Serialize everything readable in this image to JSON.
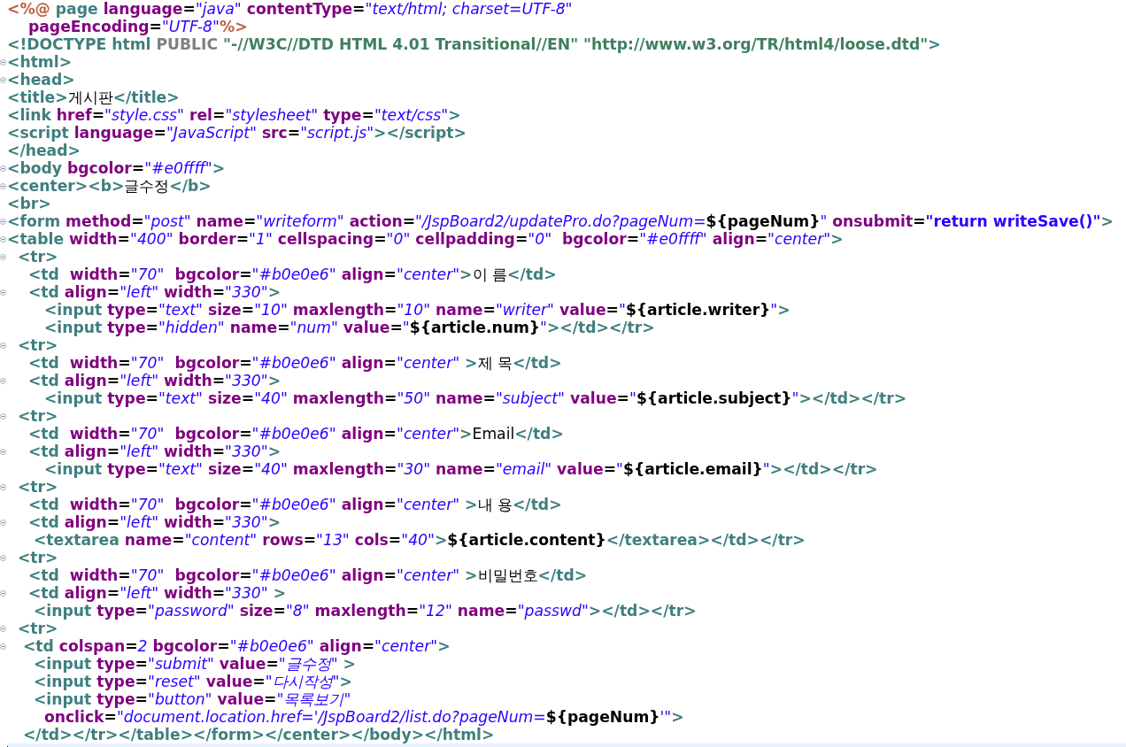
{
  "editor": {
    "lines": [
      {
        "fold": false,
        "current": false,
        "tokens": [
          {
            "kind": "directive",
            "text": "<%@"
          },
          {
            "kind": "dirname",
            "text": " page"
          },
          {
            "kind": "attr",
            "text": " language"
          },
          {
            "kind": "eq",
            "text": "="
          },
          {
            "kind": "value",
            "text": "\"java\""
          },
          {
            "kind": "attr",
            "text": " contentType"
          },
          {
            "kind": "eq",
            "text": "="
          },
          {
            "kind": "value",
            "text": "\"text/html; charset=UTF-8\""
          }
        ]
      },
      {
        "fold": false,
        "current": false,
        "tokens": [
          {
            "kind": "attr",
            "text": "    pageEncoding"
          },
          {
            "kind": "eq",
            "text": "="
          },
          {
            "kind": "value",
            "text": "\"UTF-8\""
          },
          {
            "kind": "directive",
            "text": "%>"
          }
        ]
      },
      {
        "fold": false,
        "current": false,
        "tokens": [
          {
            "kind": "tag",
            "text": "<!DOCTYPE html"
          },
          {
            "kind": "doctype",
            "text": " PUBLIC"
          },
          {
            "kind": "dtdstring",
            "text": " \"-//W3C//DTD HTML 4.01 Transitional//EN\" \"http://www.w3.org/TR/html4/loose.dtd\""
          },
          {
            "kind": "tag",
            "text": ">"
          }
        ]
      },
      {
        "fold": true,
        "current": false,
        "tokens": [
          {
            "kind": "tag",
            "text": "<html>"
          }
        ]
      },
      {
        "fold": true,
        "current": false,
        "tokens": [
          {
            "kind": "tag",
            "text": "<head>"
          }
        ]
      },
      {
        "fold": false,
        "current": false,
        "tokens": [
          {
            "kind": "tag",
            "text": "<title>"
          },
          {
            "kind": "text",
            "text": "게시판"
          },
          {
            "kind": "tag",
            "text": "</title>"
          }
        ]
      },
      {
        "fold": false,
        "current": false,
        "tokens": [
          {
            "kind": "tag",
            "text": "<link"
          },
          {
            "kind": "attr",
            "text": " href"
          },
          {
            "kind": "eq",
            "text": "="
          },
          {
            "kind": "value",
            "text": "\"style.css\""
          },
          {
            "kind": "attr",
            "text": " rel"
          },
          {
            "kind": "eq",
            "text": "="
          },
          {
            "kind": "value",
            "text": "\"stylesheet\""
          },
          {
            "kind": "attr",
            "text": " type"
          },
          {
            "kind": "eq",
            "text": "="
          },
          {
            "kind": "value",
            "text": "\"text/css\""
          },
          {
            "kind": "tag",
            "text": ">"
          }
        ]
      },
      {
        "fold": false,
        "current": false,
        "tokens": [
          {
            "kind": "tag",
            "text": "<script"
          },
          {
            "kind": "attr",
            "text": " language"
          },
          {
            "kind": "eq",
            "text": "="
          },
          {
            "kind": "value",
            "text": "\"JavaScript\""
          },
          {
            "kind": "attr",
            "text": " src"
          },
          {
            "kind": "eq",
            "text": "="
          },
          {
            "kind": "value",
            "text": "\"script.js\""
          },
          {
            "kind": "tag",
            "text": "></script>"
          }
        ]
      },
      {
        "fold": false,
        "current": false,
        "tokens": [
          {
            "kind": "tag",
            "text": "</head>"
          }
        ]
      },
      {
        "fold": true,
        "current": false,
        "tokens": [
          {
            "kind": "tag",
            "text": "<body"
          },
          {
            "kind": "attr",
            "text": " bgcolor"
          },
          {
            "kind": "eq",
            "text": "="
          },
          {
            "kind": "value",
            "text": "\"#e0ffff\""
          },
          {
            "kind": "tag",
            "text": ">"
          }
        ]
      },
      {
        "fold": true,
        "current": false,
        "tokens": [
          {
            "kind": "tag",
            "text": "<center><b>"
          },
          {
            "kind": "text",
            "text": "글수정"
          },
          {
            "kind": "tag",
            "text": "</b>"
          }
        ]
      },
      {
        "fold": false,
        "current": false,
        "tokens": [
          {
            "kind": "tag",
            "text": "<br>"
          }
        ]
      },
      {
        "fold": true,
        "current": false,
        "tokens": [
          {
            "kind": "tag",
            "text": "<form"
          },
          {
            "kind": "attr",
            "text": " method"
          },
          {
            "kind": "eq",
            "text": "="
          },
          {
            "kind": "value",
            "text": "\"post\""
          },
          {
            "kind": "attr",
            "text": " name"
          },
          {
            "kind": "eq",
            "text": "="
          },
          {
            "kind": "value",
            "text": "\"writeform\""
          },
          {
            "kind": "attr",
            "text": " action"
          },
          {
            "kind": "eq",
            "text": "="
          },
          {
            "kind": "value",
            "text": "\"/JspBoard2/updatePro.do?pageNum="
          },
          {
            "kind": "el",
            "text": "${pageNum}"
          },
          {
            "kind": "value",
            "text": "\""
          },
          {
            "kind": "attr",
            "text": " onsubmit"
          },
          {
            "kind": "eq",
            "text": "="
          },
          {
            "kind": "script",
            "text": "\"return writeSave()\""
          },
          {
            "kind": "tag",
            "text": ">"
          }
        ]
      },
      {
        "fold": true,
        "current": false,
        "tokens": [
          {
            "kind": "tag",
            "text": "<table"
          },
          {
            "kind": "attr",
            "text": " width"
          },
          {
            "kind": "eq",
            "text": "="
          },
          {
            "kind": "value",
            "text": "\"400\""
          },
          {
            "kind": "attr",
            "text": " border"
          },
          {
            "kind": "eq",
            "text": "="
          },
          {
            "kind": "value",
            "text": "\"1\""
          },
          {
            "kind": "attr",
            "text": " cellspacing"
          },
          {
            "kind": "eq",
            "text": "="
          },
          {
            "kind": "value",
            "text": "\"0\""
          },
          {
            "kind": "attr",
            "text": " cellpadding"
          },
          {
            "kind": "eq",
            "text": "="
          },
          {
            "kind": "value",
            "text": "\"0\""
          },
          {
            "kind": "attr",
            "text": "  bgcolor"
          },
          {
            "kind": "eq",
            "text": "="
          },
          {
            "kind": "value",
            "text": "\"#e0ffff\""
          },
          {
            "kind": "attr",
            "text": " align"
          },
          {
            "kind": "eq",
            "text": "="
          },
          {
            "kind": "value",
            "text": "\"center\""
          },
          {
            "kind": "tag",
            "text": ">"
          }
        ]
      },
      {
        "fold": true,
        "current": false,
        "tokens": [
          {
            "kind": "tag",
            "text": "  <tr>"
          }
        ]
      },
      {
        "fold": false,
        "current": false,
        "tokens": [
          {
            "kind": "tag",
            "text": "    <td"
          },
          {
            "kind": "attr",
            "text": "  width"
          },
          {
            "kind": "eq",
            "text": "="
          },
          {
            "kind": "value",
            "text": "\"70\""
          },
          {
            "kind": "attr",
            "text": "  bgcolor"
          },
          {
            "kind": "eq",
            "text": "="
          },
          {
            "kind": "value",
            "text": "\"#b0e0e6\""
          },
          {
            "kind": "attr",
            "text": " align"
          },
          {
            "kind": "eq",
            "text": "="
          },
          {
            "kind": "value",
            "text": "\"center\""
          },
          {
            "kind": "tag",
            "text": ">"
          },
          {
            "kind": "text",
            "text": "이 름"
          },
          {
            "kind": "tag",
            "text": "</td>"
          }
        ]
      },
      {
        "fold": true,
        "current": false,
        "tokens": [
          {
            "kind": "tag",
            "text": "    <td"
          },
          {
            "kind": "attr",
            "text": " align"
          },
          {
            "kind": "eq",
            "text": "="
          },
          {
            "kind": "value",
            "text": "\"left\""
          },
          {
            "kind": "attr",
            "text": " width"
          },
          {
            "kind": "eq",
            "text": "="
          },
          {
            "kind": "value",
            "text": "\"330\""
          },
          {
            "kind": "tag",
            "text": ">"
          }
        ]
      },
      {
        "fold": false,
        "current": false,
        "tokens": [
          {
            "kind": "tag",
            "text": "       <input"
          },
          {
            "kind": "attr",
            "text": " type"
          },
          {
            "kind": "eq",
            "text": "="
          },
          {
            "kind": "value",
            "text": "\"text\""
          },
          {
            "kind": "attr",
            "text": " size"
          },
          {
            "kind": "eq",
            "text": "="
          },
          {
            "kind": "value",
            "text": "\"10\""
          },
          {
            "kind": "attr",
            "text": " maxlength"
          },
          {
            "kind": "eq",
            "text": "="
          },
          {
            "kind": "value",
            "text": "\"10\""
          },
          {
            "kind": "attr",
            "text": " name"
          },
          {
            "kind": "eq",
            "text": "="
          },
          {
            "kind": "value",
            "text": "\"writer\""
          },
          {
            "kind": "attr",
            "text": " value"
          },
          {
            "kind": "eq",
            "text": "="
          },
          {
            "kind": "value",
            "text": "\""
          },
          {
            "kind": "el",
            "text": "${article.writer}"
          },
          {
            "kind": "value",
            "text": "\""
          },
          {
            "kind": "tag",
            "text": ">"
          }
        ]
      },
      {
        "fold": false,
        "current": false,
        "tokens": [
          {
            "kind": "tag",
            "text": "       <input"
          },
          {
            "kind": "attr",
            "text": " type"
          },
          {
            "kind": "eq",
            "text": "="
          },
          {
            "kind": "value",
            "text": "\"hidden\""
          },
          {
            "kind": "attr",
            "text": " name"
          },
          {
            "kind": "eq",
            "text": "="
          },
          {
            "kind": "value",
            "text": "\"num\""
          },
          {
            "kind": "attr",
            "text": " value"
          },
          {
            "kind": "eq",
            "text": "="
          },
          {
            "kind": "value",
            "text": "\""
          },
          {
            "kind": "el",
            "text": "${article.num}"
          },
          {
            "kind": "value",
            "text": "\""
          },
          {
            "kind": "tag",
            "text": "></td></tr>"
          }
        ]
      },
      {
        "fold": true,
        "current": false,
        "tokens": [
          {
            "kind": "tag",
            "text": "  <tr>"
          }
        ]
      },
      {
        "fold": false,
        "current": false,
        "tokens": [
          {
            "kind": "tag",
            "text": "    <td"
          },
          {
            "kind": "attr",
            "text": "  width"
          },
          {
            "kind": "eq",
            "text": "="
          },
          {
            "kind": "value",
            "text": "\"70\""
          },
          {
            "kind": "attr",
            "text": "  bgcolor"
          },
          {
            "kind": "eq",
            "text": "="
          },
          {
            "kind": "value",
            "text": "\"#b0e0e6\""
          },
          {
            "kind": "attr",
            "text": " align"
          },
          {
            "kind": "eq",
            "text": "="
          },
          {
            "kind": "value",
            "text": "\"center\""
          },
          {
            "kind": "tag",
            "text": " >"
          },
          {
            "kind": "text",
            "text": "제 목"
          },
          {
            "kind": "tag",
            "text": "</td>"
          }
        ]
      },
      {
        "fold": true,
        "current": false,
        "tokens": [
          {
            "kind": "tag",
            "text": "    <td"
          },
          {
            "kind": "attr",
            "text": " align"
          },
          {
            "kind": "eq",
            "text": "="
          },
          {
            "kind": "value",
            "text": "\"left\""
          },
          {
            "kind": "attr",
            "text": " width"
          },
          {
            "kind": "eq",
            "text": "="
          },
          {
            "kind": "value",
            "text": "\"330\""
          },
          {
            "kind": "tag",
            "text": ">"
          }
        ]
      },
      {
        "fold": false,
        "current": false,
        "tokens": [
          {
            "kind": "tag",
            "text": "       <input"
          },
          {
            "kind": "attr",
            "text": " type"
          },
          {
            "kind": "eq",
            "text": "="
          },
          {
            "kind": "value",
            "text": "\"text\""
          },
          {
            "kind": "attr",
            "text": " size"
          },
          {
            "kind": "eq",
            "text": "="
          },
          {
            "kind": "value",
            "text": "\"40\""
          },
          {
            "kind": "attr",
            "text": " maxlength"
          },
          {
            "kind": "eq",
            "text": "="
          },
          {
            "kind": "value",
            "text": "\"50\""
          },
          {
            "kind": "attr",
            "text": " name"
          },
          {
            "kind": "eq",
            "text": "="
          },
          {
            "kind": "value",
            "text": "\"subject\""
          },
          {
            "kind": "attr",
            "text": " value"
          },
          {
            "kind": "eq",
            "text": "="
          },
          {
            "kind": "value",
            "text": "\""
          },
          {
            "kind": "el",
            "text": "${article.subject}"
          },
          {
            "kind": "value",
            "text": "\""
          },
          {
            "kind": "tag",
            "text": "></td></tr>"
          }
        ]
      },
      {
        "fold": true,
        "current": false,
        "tokens": [
          {
            "kind": "tag",
            "text": "  <tr>"
          }
        ]
      },
      {
        "fold": false,
        "current": false,
        "tokens": [
          {
            "kind": "tag",
            "text": "    <td"
          },
          {
            "kind": "attr",
            "text": "  width"
          },
          {
            "kind": "eq",
            "text": "="
          },
          {
            "kind": "value",
            "text": "\"70\""
          },
          {
            "kind": "attr",
            "text": "  bgcolor"
          },
          {
            "kind": "eq",
            "text": "="
          },
          {
            "kind": "value",
            "text": "\"#b0e0e6\""
          },
          {
            "kind": "attr",
            "text": " align"
          },
          {
            "kind": "eq",
            "text": "="
          },
          {
            "kind": "value",
            "text": "\"center\""
          },
          {
            "kind": "tag",
            "text": ">"
          },
          {
            "kind": "text",
            "text": "Email"
          },
          {
            "kind": "tag",
            "text": "</td>"
          }
        ]
      },
      {
        "fold": true,
        "current": false,
        "tokens": [
          {
            "kind": "tag",
            "text": "    <td"
          },
          {
            "kind": "attr",
            "text": " align"
          },
          {
            "kind": "eq",
            "text": "="
          },
          {
            "kind": "value",
            "text": "\"left\""
          },
          {
            "kind": "attr",
            "text": " width"
          },
          {
            "kind": "eq",
            "text": "="
          },
          {
            "kind": "value",
            "text": "\"330\""
          },
          {
            "kind": "tag",
            "text": ">"
          }
        ]
      },
      {
        "fold": false,
        "current": false,
        "tokens": [
          {
            "kind": "tag",
            "text": "       <input"
          },
          {
            "kind": "attr",
            "text": " type"
          },
          {
            "kind": "eq",
            "text": "="
          },
          {
            "kind": "value",
            "text": "\"text\""
          },
          {
            "kind": "attr",
            "text": " size"
          },
          {
            "kind": "eq",
            "text": "="
          },
          {
            "kind": "value",
            "text": "\"40\""
          },
          {
            "kind": "attr",
            "text": " maxlength"
          },
          {
            "kind": "eq",
            "text": "="
          },
          {
            "kind": "value",
            "text": "\"30\""
          },
          {
            "kind": "attr",
            "text": " name"
          },
          {
            "kind": "eq",
            "text": "="
          },
          {
            "kind": "value",
            "text": "\"email\""
          },
          {
            "kind": "attr",
            "text": " value"
          },
          {
            "kind": "eq",
            "text": "="
          },
          {
            "kind": "value",
            "text": "\""
          },
          {
            "kind": "el",
            "text": "${article.email}"
          },
          {
            "kind": "value",
            "text": "\""
          },
          {
            "kind": "tag",
            "text": "></td></tr>"
          }
        ]
      },
      {
        "fold": true,
        "current": false,
        "tokens": [
          {
            "kind": "tag",
            "text": "  <tr>"
          }
        ]
      },
      {
        "fold": false,
        "current": false,
        "tokens": [
          {
            "kind": "tag",
            "text": "    <td"
          },
          {
            "kind": "attr",
            "text": "  width"
          },
          {
            "kind": "eq",
            "text": "="
          },
          {
            "kind": "value",
            "text": "\"70\""
          },
          {
            "kind": "attr",
            "text": "  bgcolor"
          },
          {
            "kind": "eq",
            "text": "="
          },
          {
            "kind": "value",
            "text": "\"#b0e0e6\""
          },
          {
            "kind": "attr",
            "text": " align"
          },
          {
            "kind": "eq",
            "text": "="
          },
          {
            "kind": "value",
            "text": "\"center\""
          },
          {
            "kind": "tag",
            "text": " >"
          },
          {
            "kind": "text",
            "text": "내 용"
          },
          {
            "kind": "tag",
            "text": "</td>"
          }
        ]
      },
      {
        "fold": true,
        "current": false,
        "tokens": [
          {
            "kind": "tag",
            "text": "    <td"
          },
          {
            "kind": "attr",
            "text": " align"
          },
          {
            "kind": "eq",
            "text": "="
          },
          {
            "kind": "value",
            "text": "\"left\""
          },
          {
            "kind": "attr",
            "text": " width"
          },
          {
            "kind": "eq",
            "text": "="
          },
          {
            "kind": "value",
            "text": "\"330\""
          },
          {
            "kind": "tag",
            "text": ">"
          }
        ]
      },
      {
        "fold": false,
        "current": false,
        "tokens": [
          {
            "kind": "tag",
            "text": "     <textarea"
          },
          {
            "kind": "attr",
            "text": " name"
          },
          {
            "kind": "eq",
            "text": "="
          },
          {
            "kind": "value",
            "text": "\"content\""
          },
          {
            "kind": "attr",
            "text": " rows"
          },
          {
            "kind": "eq",
            "text": "="
          },
          {
            "kind": "value",
            "text": "\"13\""
          },
          {
            "kind": "attr",
            "text": " cols"
          },
          {
            "kind": "eq",
            "text": "="
          },
          {
            "kind": "value",
            "text": "\"40\""
          },
          {
            "kind": "tag",
            "text": ">"
          },
          {
            "kind": "el",
            "text": "${article.content}"
          },
          {
            "kind": "tag",
            "text": "</textarea></td></tr>"
          }
        ]
      },
      {
        "fold": true,
        "current": false,
        "tokens": [
          {
            "kind": "tag",
            "text": "  <tr>"
          }
        ]
      },
      {
        "fold": false,
        "current": false,
        "tokens": [
          {
            "kind": "tag",
            "text": "    <td"
          },
          {
            "kind": "attr",
            "text": "  width"
          },
          {
            "kind": "eq",
            "text": "="
          },
          {
            "kind": "value",
            "text": "\"70\""
          },
          {
            "kind": "attr",
            "text": "  bgcolor"
          },
          {
            "kind": "eq",
            "text": "="
          },
          {
            "kind": "value",
            "text": "\"#b0e0e6\""
          },
          {
            "kind": "attr",
            "text": " align"
          },
          {
            "kind": "eq",
            "text": "="
          },
          {
            "kind": "value",
            "text": "\"center\""
          },
          {
            "kind": "tag",
            "text": " >"
          },
          {
            "kind": "text",
            "text": "비밀번호"
          },
          {
            "kind": "tag",
            "text": "</td>"
          }
        ]
      },
      {
        "fold": true,
        "current": false,
        "tokens": [
          {
            "kind": "tag",
            "text": "    <td"
          },
          {
            "kind": "attr",
            "text": " align"
          },
          {
            "kind": "eq",
            "text": "="
          },
          {
            "kind": "value",
            "text": "\"left\""
          },
          {
            "kind": "attr",
            "text": " width"
          },
          {
            "kind": "eq",
            "text": "="
          },
          {
            "kind": "value",
            "text": "\"330\""
          },
          {
            "kind": "tag",
            "text": " >"
          }
        ]
      },
      {
        "fold": false,
        "current": false,
        "tokens": [
          {
            "kind": "tag",
            "text": "     <input"
          },
          {
            "kind": "attr",
            "text": " type"
          },
          {
            "kind": "eq",
            "text": "="
          },
          {
            "kind": "value",
            "text": "\"password\""
          },
          {
            "kind": "attr",
            "text": " size"
          },
          {
            "kind": "eq",
            "text": "="
          },
          {
            "kind": "value",
            "text": "\"8\""
          },
          {
            "kind": "attr",
            "text": " maxlength"
          },
          {
            "kind": "eq",
            "text": "="
          },
          {
            "kind": "value",
            "text": "\"12\""
          },
          {
            "kind": "attr",
            "text": " name"
          },
          {
            "kind": "eq",
            "text": "="
          },
          {
            "kind": "value",
            "text": "\"passwd\""
          },
          {
            "kind": "tag",
            "text": "></td></tr>"
          }
        ]
      },
      {
        "fold": true,
        "current": false,
        "tokens": [
          {
            "kind": "tag",
            "text": "  <tr>"
          }
        ]
      },
      {
        "fold": true,
        "current": false,
        "tokens": [
          {
            "kind": "tag",
            "text": "   <td"
          },
          {
            "kind": "attr",
            "text": " colspan"
          },
          {
            "kind": "eq",
            "text": "="
          },
          {
            "kind": "value",
            "text": "2"
          },
          {
            "kind": "attr",
            "text": " bgcolor"
          },
          {
            "kind": "eq",
            "text": "="
          },
          {
            "kind": "value",
            "text": "\"#b0e0e6\""
          },
          {
            "kind": "attr",
            "text": " align"
          },
          {
            "kind": "eq",
            "text": "="
          },
          {
            "kind": "value",
            "text": "\"center\""
          },
          {
            "kind": "tag",
            "text": ">"
          }
        ]
      },
      {
        "fold": false,
        "current": false,
        "tokens": [
          {
            "kind": "tag",
            "text": "     <input"
          },
          {
            "kind": "attr",
            "text": " type"
          },
          {
            "kind": "eq",
            "text": "="
          },
          {
            "kind": "value",
            "text": "\"submit\""
          },
          {
            "kind": "attr",
            "text": " value"
          },
          {
            "kind": "eq",
            "text": "="
          },
          {
            "kind": "value",
            "text": "\"글수정\""
          },
          {
            "kind": "tag",
            "text": " >"
          }
        ]
      },
      {
        "fold": false,
        "current": false,
        "tokens": [
          {
            "kind": "tag",
            "text": "     <input"
          },
          {
            "kind": "attr",
            "text": " type"
          },
          {
            "kind": "eq",
            "text": "="
          },
          {
            "kind": "value",
            "text": "\"reset\""
          },
          {
            "kind": "attr",
            "text": " value"
          },
          {
            "kind": "eq",
            "text": "="
          },
          {
            "kind": "value",
            "text": "\"다시작성\""
          },
          {
            "kind": "tag",
            "text": ">"
          }
        ]
      },
      {
        "fold": false,
        "current": false,
        "tokens": [
          {
            "kind": "tag",
            "text": "     <input"
          },
          {
            "kind": "attr",
            "text": " type"
          },
          {
            "kind": "eq",
            "text": "="
          },
          {
            "kind": "value",
            "text": "\"button\""
          },
          {
            "kind": "attr",
            "text": " value"
          },
          {
            "kind": "eq",
            "text": "="
          },
          {
            "kind": "value",
            "text": "\"목록보기\""
          }
        ]
      },
      {
        "fold": false,
        "current": false,
        "tokens": [
          {
            "kind": "attr",
            "text": "       onclick"
          },
          {
            "kind": "eq",
            "text": "="
          },
          {
            "kind": "value",
            "text": "\"document.location.href='/JspBoard2/list.do?pageNum="
          },
          {
            "kind": "el",
            "text": "${pageNum}"
          },
          {
            "kind": "value",
            "text": "'\""
          },
          {
            "kind": "tag",
            "text": ">"
          }
        ]
      },
      {
        "fold": false,
        "current": false,
        "tokens": [
          {
            "kind": "tag",
            "text": "   </td></tr></table></form></center></body></html>"
          }
        ]
      },
      {
        "fold": false,
        "current": true
      }
    ]
  }
}
